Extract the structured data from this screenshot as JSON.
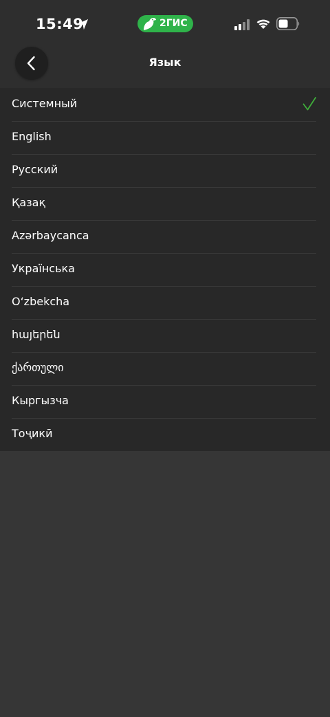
{
  "status_bar": {
    "time": "15:49",
    "app_badge": "2ГИС",
    "accent_color": "#2fb34a"
  },
  "header": {
    "title": "Язык",
    "back_icon": "chevron-left-icon"
  },
  "languages": [
    {
      "label": "Системный",
      "selected": true
    },
    {
      "label": "English",
      "selected": false
    },
    {
      "label": "Русский",
      "selected": false
    },
    {
      "label": "Қазақ",
      "selected": false
    },
    {
      "label": "Azərbaycanca",
      "selected": false
    },
    {
      "label": "Українська",
      "selected": false
    },
    {
      "label": "O‘zbekcha",
      "selected": false
    },
    {
      "label": "հայերեն",
      "selected": false
    },
    {
      "label": "ქართული",
      "selected": false
    },
    {
      "label": "Кыргызча",
      "selected": false
    },
    {
      "label": "Тоҷикӣ",
      "selected": false
    }
  ],
  "check_color": "#3fae3a"
}
